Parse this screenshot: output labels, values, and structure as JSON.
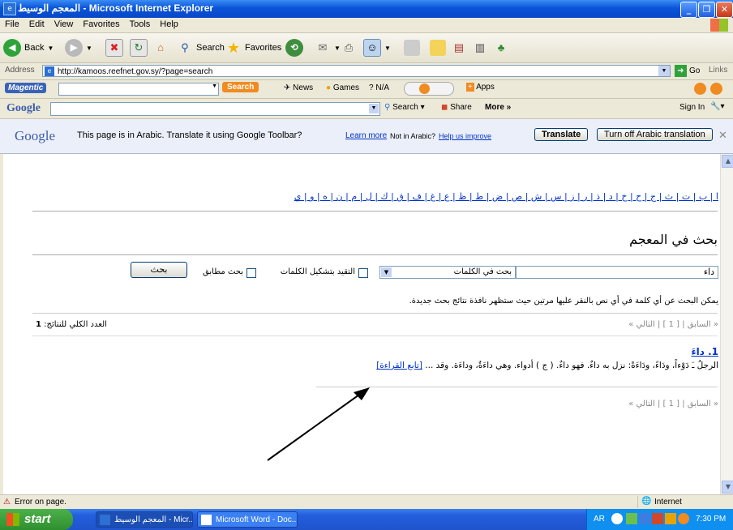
{
  "window": {
    "title": "المعجم الوسيط - Microsoft Internet Explorer"
  },
  "menu": [
    "File",
    "Edit",
    "View",
    "Favorites",
    "Tools",
    "Help"
  ],
  "toolbar": {
    "back": "Back",
    "search": "Search",
    "favorites": "Favorites"
  },
  "address": {
    "label": "Address",
    "url": "http://kamoos.reefnet.gov.sy/?page=search",
    "go": "Go",
    "links": "Links"
  },
  "magentic": {
    "brand": "Magentic",
    "search": "Search",
    "news": "News",
    "games": "Games",
    "na": "N/A",
    "apps": "Apps"
  },
  "google": {
    "brand": "Google",
    "search": "Search",
    "share": "Share",
    "more": "More »",
    "signin": "Sign In"
  },
  "translate": {
    "brand": "Google",
    "message": "This page is in Arabic.  Translate it using Google Toolbar?",
    "learn_more": "Learn more",
    "not_arabic": "Not in Arabic?",
    "help": "Help us improve",
    "translate_btn": "Translate",
    "turn_off_btn": "Turn off Arabic translation"
  },
  "page": {
    "alphabet": "ا | ب | ت | ث | ج | ح | خ | د | ذ | ر | ز | س | ش | ص | ض | ط | ظ | ع | غ | ف | ق | ك | ل | م | ن | ه | و | ي",
    "heading": "بحث في المعجم",
    "search_value": "داء",
    "select_value": "بحث في الكلمات",
    "option_diacritics": "التقيد بتشكيل الكلمات",
    "option_exact": "بحث مطابق",
    "search_button": "بحث",
    "hint": "يمكن البحث عن أي كلمة في أي نص بالنقر عليها مرتين حيث ستظهر نافذة نتائج بحث جديدة.",
    "total_label": "العدد الكلي للنتائج:",
    "total_value": "1",
    "pager": "« السابق | [ 1 ] | التالي »",
    "result_title": "1. داءَ",
    "result_text": "الرجلُ ـَ دَوْءاً، ودَاءً، ودَاءَةً: نزل به داءٌ. فهو داءٌ. ( ج ) أدواء. وهي داءَةٌ، وداءَة. وقد ...",
    "result_link": "[تابع القراءة]"
  },
  "status": {
    "left": "Error on page.",
    "zone": "Internet"
  },
  "taskbar": {
    "start": "start",
    "task1": "المعجم الوسيط - Micr...",
    "task2": "Microsoft Word - Doc...",
    "lang": "AR",
    "clock": "7:30 PM"
  }
}
